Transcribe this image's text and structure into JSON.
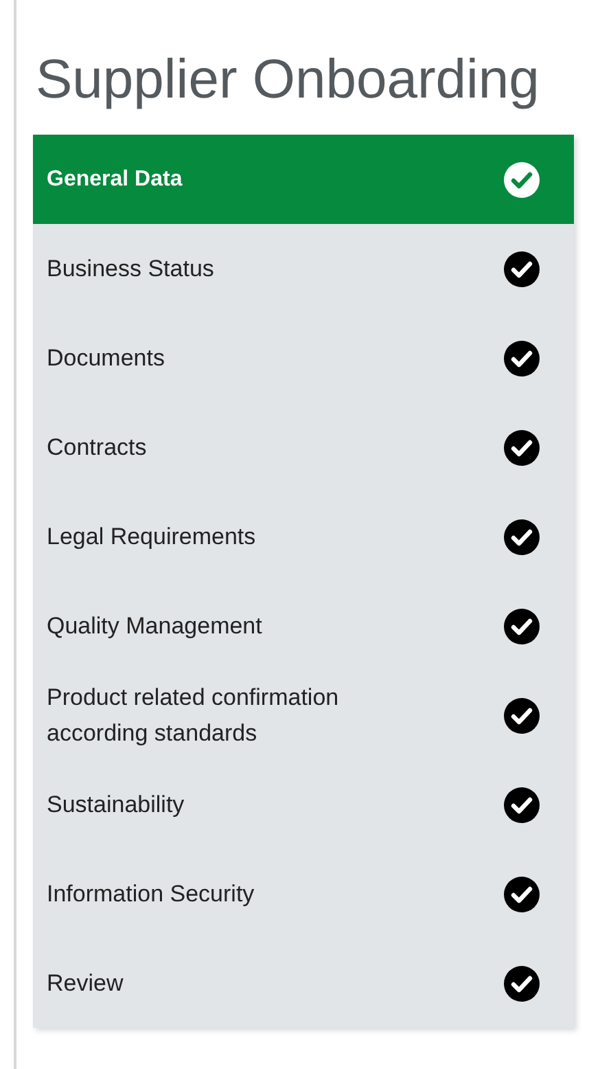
{
  "title": "Supplier Onboarding",
  "steps": [
    {
      "label": "General Data",
      "selected": true,
      "completed": true
    },
    {
      "label": "Business Status",
      "selected": false,
      "completed": true
    },
    {
      "label": "Documents",
      "selected": false,
      "completed": true
    },
    {
      "label": "Contracts",
      "selected": false,
      "completed": true
    },
    {
      "label": "Legal Requirements",
      "selected": false,
      "completed": true
    },
    {
      "label": "Quality Management",
      "selected": false,
      "completed": true
    },
    {
      "label": "Product related confirmation according standards",
      "selected": false,
      "completed": true
    },
    {
      "label": "Sustainability",
      "selected": false,
      "completed": true
    },
    {
      "label": "Information Security",
      "selected": false,
      "completed": true
    },
    {
      "label": "Review",
      "selected": false,
      "completed": true
    }
  ]
}
